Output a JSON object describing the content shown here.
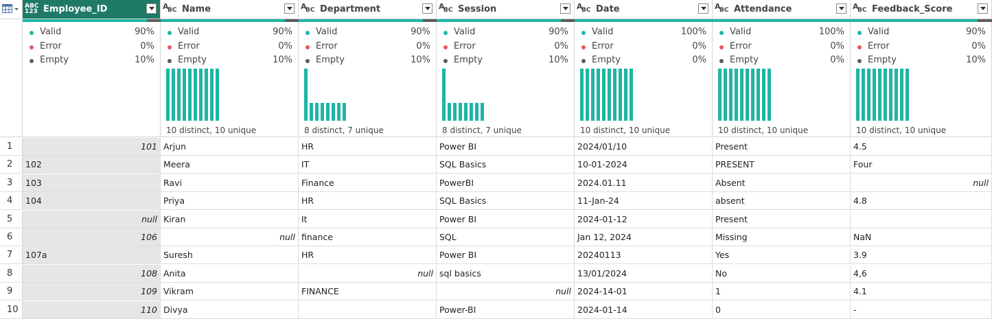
{
  "columns": [
    {
      "name": "Employee_ID",
      "type_top": "ABC",
      "type_bottom": "123",
      "valid": "90%",
      "error": "0%",
      "empty": "10%",
      "distinct": "",
      "bars": [],
      "selected": true,
      "valid_frac": 0.9
    },
    {
      "name": "Name",
      "type_top": "A",
      "type_bottom": "BC",
      "valid": "90%",
      "error": "0%",
      "empty": "10%",
      "distinct": "10 distinct, 10 unique",
      "bars": [
        1,
        1,
        1,
        1,
        1,
        1,
        1,
        1,
        1,
        1
      ],
      "selected": false,
      "valid_frac": 0.9
    },
    {
      "name": "Department",
      "type_top": "A",
      "type_bottom": "BC",
      "valid": "90%",
      "error": "0%",
      "empty": "10%",
      "distinct": "8 distinct, 7 unique",
      "bars": [
        2,
        1,
        1,
        1,
        1,
        1,
        1,
        1
      ],
      "selected": false,
      "valid_frac": 0.9
    },
    {
      "name": "Session",
      "type_top": "A",
      "type_bottom": "BC",
      "valid": "90%",
      "error": "0%",
      "empty": "10%",
      "distinct": "8 distinct, 7 unique",
      "bars": [
        2,
        1,
        1,
        1,
        1,
        1,
        1,
        1
      ],
      "selected": false,
      "valid_frac": 0.9
    },
    {
      "name": "Date",
      "type_top": "A",
      "type_bottom": "BC",
      "valid": "100%",
      "error": "0%",
      "empty": "0%",
      "distinct": "10 distinct, 10 unique",
      "bars": [
        1,
        1,
        1,
        1,
        1,
        1,
        1,
        1,
        1,
        1
      ],
      "selected": false,
      "valid_frac": 1.0
    },
    {
      "name": "Attendance",
      "type_top": "A",
      "type_bottom": "BC",
      "valid": "100%",
      "error": "0%",
      "empty": "0%",
      "distinct": "10 distinct, 10 unique",
      "bars": [
        1,
        1,
        1,
        1,
        1,
        1,
        1,
        1,
        1,
        1
      ],
      "selected": false,
      "valid_frac": 1.0
    },
    {
      "name": "Feedback_Score",
      "type_top": "A",
      "type_bottom": "BC",
      "valid": "90%",
      "error": "0%",
      "empty": "10%",
      "distinct": "10 distinct, 10 unique",
      "bars": [
        1,
        1,
        1,
        1,
        1,
        1,
        1,
        1,
        1,
        1
      ],
      "selected": false,
      "valid_frac": 0.9
    }
  ],
  "quality_labels": {
    "valid": "Valid",
    "error": "Error",
    "empty": "Empty"
  },
  "colors": {
    "valid": "#1fb5a5",
    "error": "#e8585e",
    "empty": "#5c5c5c",
    "selected_header": "#1e7a66"
  },
  "rows": [
    {
      "n": "1",
      "cells": [
        {
          "v": "101",
          "r": true
        },
        {
          "v": "Arjun"
        },
        {
          "v": "HR"
        },
        {
          "v": "Power BI"
        },
        {
          "v": "2024/01/10"
        },
        {
          "v": "Present"
        },
        {
          "v": "4.5"
        }
      ]
    },
    {
      "n": "2",
      "cells": [
        {
          "v": "102"
        },
        {
          "v": "Meera"
        },
        {
          "v": "IT"
        },
        {
          "v": "SQL Basics"
        },
        {
          "v": "10-01-2024"
        },
        {
          "v": "PRESENT"
        },
        {
          "v": "Four"
        }
      ]
    },
    {
      "n": "3",
      "cells": [
        {
          "v": "103"
        },
        {
          "v": "Ravi"
        },
        {
          "v": "Finance"
        },
        {
          "v": "PowerBI"
        },
        {
          "v": "2024.01.11"
        },
        {
          "v": "Absent"
        },
        {
          "v": "null",
          "r": true
        }
      ]
    },
    {
      "n": "4",
      "cells": [
        {
          "v": " 104"
        },
        {
          "v": "Priya"
        },
        {
          "v": "HR"
        },
        {
          "v": " SQL Basics"
        },
        {
          "v": "11-Jan-24"
        },
        {
          "v": "absent"
        },
        {
          "v": "4.8"
        }
      ]
    },
    {
      "n": "5",
      "cells": [
        {
          "v": "null",
          "r": true
        },
        {
          "v": "Kiran"
        },
        {
          "v": "It"
        },
        {
          "v": "Power BI"
        },
        {
          "v": "2024-01-12"
        },
        {
          "v": "Present"
        },
        {
          "v": ""
        }
      ]
    },
    {
      "n": "6",
      "cells": [
        {
          "v": "106",
          "r": true
        },
        {
          "v": "null",
          "r": true
        },
        {
          "v": "finance"
        },
        {
          "v": "SQL"
        },
        {
          "v": "Jan 12, 2024"
        },
        {
          "v": "Missing"
        },
        {
          "v": "NaN"
        }
      ]
    },
    {
      "n": "7",
      "cells": [
        {
          "v": "107a"
        },
        {
          "v": "Suresh"
        },
        {
          "v": "HR"
        },
        {
          "v": "Power BI"
        },
        {
          "v": "20240113"
        },
        {
          "v": "Yes"
        },
        {
          "v": "3.9"
        }
      ]
    },
    {
      "n": "8",
      "cells": [
        {
          "v": "108",
          "r": true
        },
        {
          "v": "Anita"
        },
        {
          "v": "null",
          "r": true
        },
        {
          "v": "sql basics"
        },
        {
          "v": "13/01/2024"
        },
        {
          "v": "No"
        },
        {
          "v": "4,6"
        }
      ]
    },
    {
      "n": "9",
      "cells": [
        {
          "v": "109",
          "r": true
        },
        {
          "v": "Vikram"
        },
        {
          "v": "FINANCE"
        },
        {
          "v": "null",
          "r": true
        },
        {
          "v": "2024-14-01"
        },
        {
          "v": "1"
        },
        {
          "v": "4.1"
        }
      ]
    },
    {
      "n": "10",
      "cells": [
        {
          "v": "110",
          "r": true
        },
        {
          "v": "Divya"
        },
        {
          "v": ""
        },
        {
          "v": "Power-BI"
        },
        {
          "v": "2024-01-14"
        },
        {
          "v": "0"
        },
        {
          "v": "-"
        }
      ]
    }
  ]
}
